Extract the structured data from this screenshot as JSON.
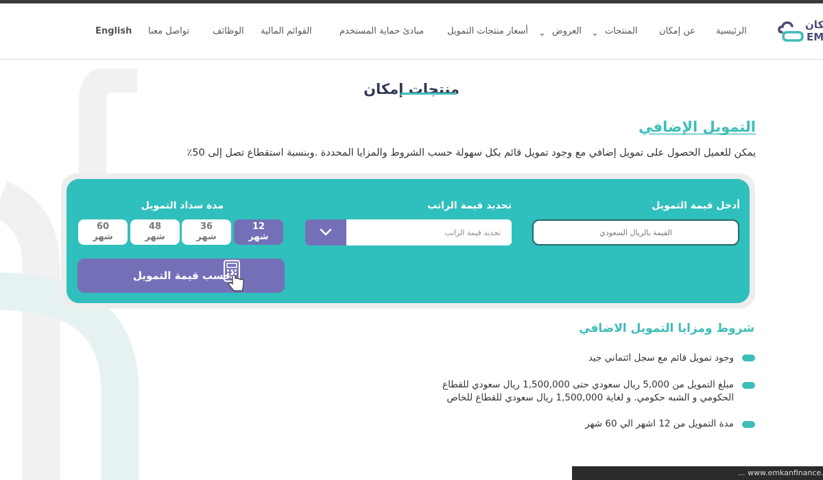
{
  "brand": {
    "logo_arabic": "مكان",
    "logo_latin": "EM",
    "accent": "#3dbdb8",
    "purple": "#7470b8",
    "icon": "emkan-cloud-logo-icon"
  },
  "nav": {
    "home": "الرئيسية",
    "about": "عن إمكان",
    "products": "المنتجات",
    "offers": "العروض",
    "prices": "أسعار منتجات التمويل",
    "principles": "مبادئ حماية المستخدم",
    "financials": "القوائم المالية",
    "jobs": "الوظائف",
    "contact": "تواصل معنا",
    "language": "English"
  },
  "page": {
    "title": "منتجات إمكان"
  },
  "product": {
    "title": "التمويل الإضافي",
    "description": "يمكن للعميل الحصول على تمويل إضافي مع وجود تمويل قائم بكل سهولة حسب الشروط والمزايا المحددة .وبنسبة استقطاع تصل إلى 50٪"
  },
  "calculator": {
    "amount_label": "أدخل قيمة التمويل",
    "amount_placeholder": "القيمة بالريال السعودي",
    "salary_label": "تحديد قيمة الراتب",
    "salary_placeholder": "تحديد قيمة الراتب",
    "duration_label": "مدة سداد التمويل",
    "month_unit": "شهر",
    "durations": [
      "12",
      "36",
      "48",
      "60"
    ],
    "selected_duration": "12",
    "calculate_label": "احسب قيمة التمويل"
  },
  "terms": {
    "title": "شروط ومزايا التمويل الاضافي",
    "items": [
      "وجود تمويل قائم مع سجل ائتماني جيد",
      "مبلغ التمويل من 5,000 ريال سعودي حتى 1,500,000 ريال سعودي للقطاع",
      "الحكومي و الشبه حكومي. و لغاية 1,500,000 ريال سعودي للقطاع للخاص",
      "مدة التمويل من 12 اشهر الي 60 شهر"
    ]
  },
  "status_bar": {
    "url": "... www.emkanfinance.c"
  }
}
